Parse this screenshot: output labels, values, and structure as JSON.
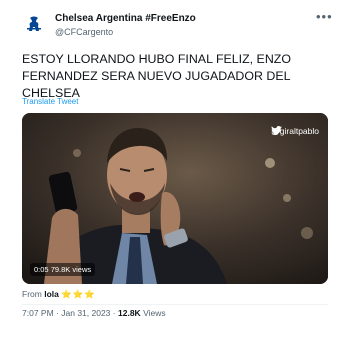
{
  "account": {
    "name": "Chelsea Argentina #FreeEnzo",
    "handle": "@CFCargento"
  },
  "tweet": {
    "text": "ESTOY LLORANDO HUBO FINAL FELIZ, ENZO FERNANDEZ SERA NUEVO JUGADADOR DEL CHELSEA",
    "translate_label": "Translate Tweet"
  },
  "media": {
    "watermark": "@giraltpablo",
    "time": "0:05",
    "views": "79.8K views"
  },
  "source": {
    "label": "From",
    "name": "lola",
    "stars": "⭐⭐⭐"
  },
  "meta": {
    "time": "7:07 PM",
    "date": "Jan 31, 2023",
    "separator": "·",
    "views_count": "12.8K",
    "views_label": "Views"
  },
  "icons": {
    "avatar": "chelsea-lion-crest-icon",
    "more": "more-options-icon",
    "watermark": "twitter-bird-icon"
  },
  "colors": {
    "link": "#1d9bf0",
    "secondary_text": "#536471",
    "primary_text": "#0f1419",
    "brand_blue": "#034694",
    "stars": "#f4b400"
  }
}
